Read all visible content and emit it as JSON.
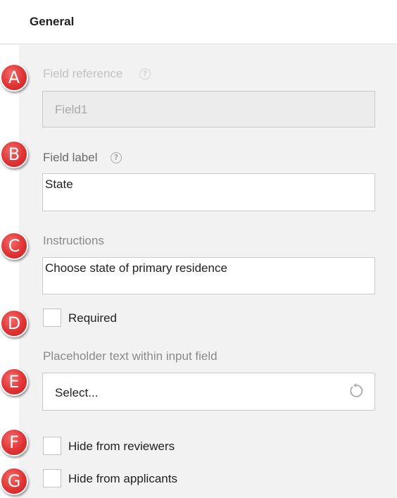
{
  "header": {
    "title": "General"
  },
  "markers": [
    "A",
    "B",
    "C",
    "D",
    "E",
    "F",
    "G"
  ],
  "field_reference": {
    "label": "Field reference",
    "value": "Field1",
    "icon": "help-icon"
  },
  "field_label": {
    "label": "Field label",
    "value": "State",
    "icon": "help-icon"
  },
  "instructions": {
    "label": "Instructions",
    "value": "Choose state of primary residence"
  },
  "required": {
    "label": "Required",
    "checked": false
  },
  "placeholder": {
    "label": "Placeholder text within input field",
    "value": "Select...",
    "icon": "reset-icon"
  },
  "hide_reviewers": {
    "label": "Hide from reviewers",
    "checked": false
  },
  "hide_applicants": {
    "label": "Hide from applicants",
    "checked": false
  },
  "colors": {
    "marker": "#e13333",
    "panel_background": "#f2f2f2",
    "disabled_text": "#c2c2c2"
  }
}
